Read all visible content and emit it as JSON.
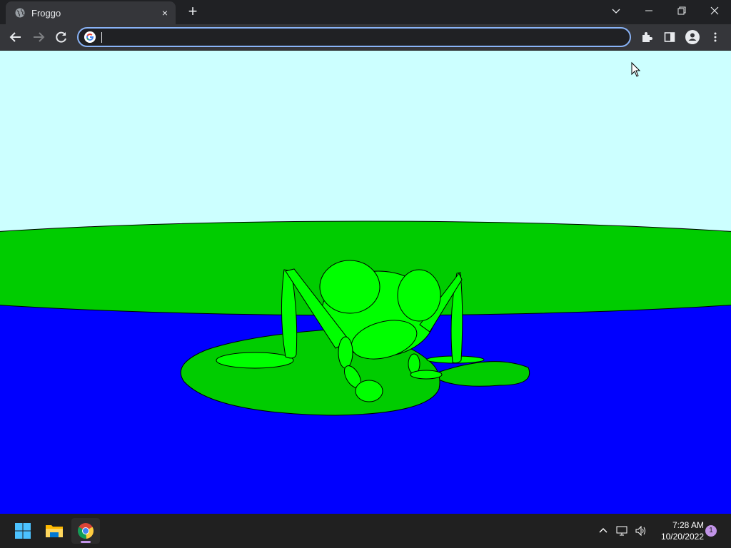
{
  "browser": {
    "tab": {
      "title": "Froggo",
      "favicon": "globe-icon",
      "close": "×"
    },
    "new_tab_label": "+",
    "omnibox": {
      "value": "",
      "placeholder": ""
    }
  },
  "page": {
    "scene": "frog on lily pad",
    "colors": {
      "sky": "#ccffff",
      "land": "#00cc00",
      "water": "#0000ff",
      "pad": "#00cc00",
      "frog": "#00ff00",
      "outline": "#000000"
    }
  },
  "taskbar": {
    "apps": [
      "windows-start-icon",
      "file-explorer-icon",
      "chrome-icon"
    ],
    "clock": {
      "time": "7:28 AM",
      "date": "10/20/2022"
    },
    "notification_count": "1"
  }
}
